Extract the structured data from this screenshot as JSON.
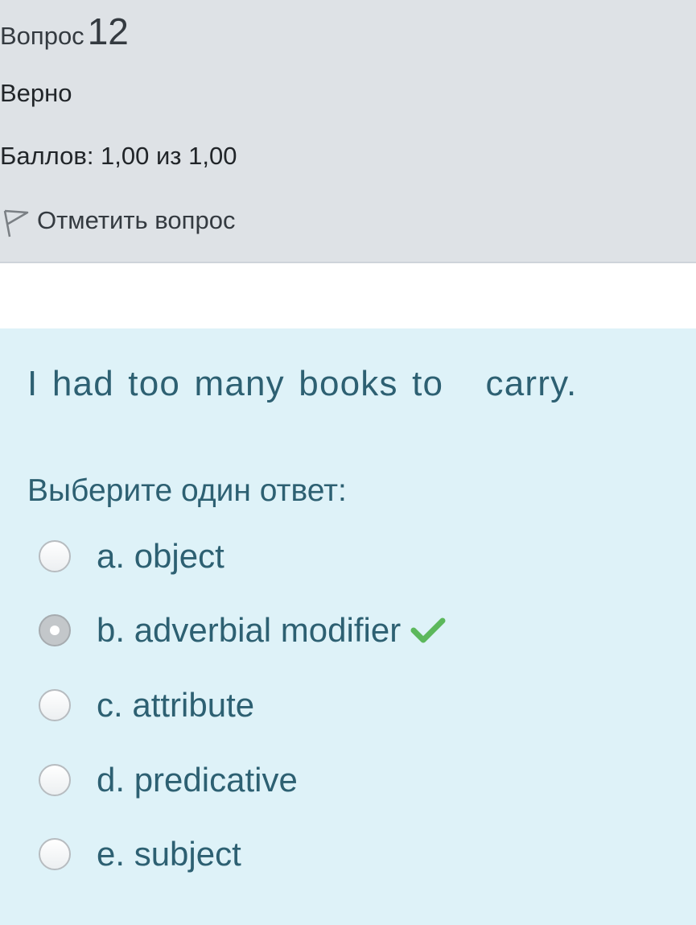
{
  "info": {
    "question_word": "Вопрос",
    "question_number": "12",
    "state": "Верно",
    "grade": "Баллов: 1,00 из 1,00",
    "flag_label": "Отметить вопрос"
  },
  "question": {
    "text": "I had too many books to   carry.",
    "prompt": "Выберите один ответ:",
    "answers": [
      {
        "label": "a. object",
        "selected": false
      },
      {
        "label": "b. adverbial modifier",
        "selected": true,
        "correct": true
      },
      {
        "label": "c. attribute",
        "selected": false
      },
      {
        "label": "d. predicative",
        "selected": false
      },
      {
        "label": "e. subject",
        "selected": false
      }
    ]
  },
  "colors": {
    "info_background": "#dee2e6",
    "content_background": "#def2f8",
    "text_teal": "#2d6072",
    "correct_green": "#5cb85c"
  },
  "icons": {
    "flag": "flag-outline-icon",
    "correct": "checkmark-icon"
  }
}
